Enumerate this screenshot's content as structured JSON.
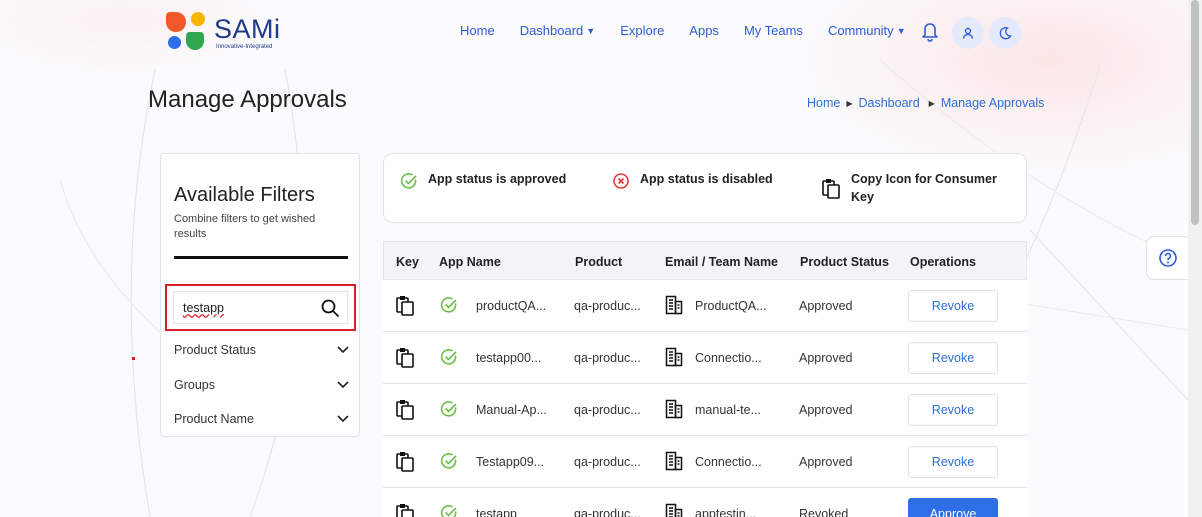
{
  "brand": {
    "name": "SAMi",
    "tagline": "Innovative-Integrated"
  },
  "nav": {
    "items": [
      {
        "label": "Home",
        "dropdown": false
      },
      {
        "label": "Dashboard",
        "dropdown": true
      },
      {
        "label": "Explore",
        "dropdown": false
      },
      {
        "label": "Apps",
        "dropdown": false
      },
      {
        "label": "My Teams",
        "dropdown": false
      },
      {
        "label": "Community",
        "dropdown": true
      }
    ],
    "icons": [
      "bell-icon",
      "user-icon",
      "moon-icon"
    ]
  },
  "page": {
    "title": "Manage Approvals"
  },
  "breadcrumb": [
    "Home",
    "Dashboard",
    "Manage Approvals"
  ],
  "filters": {
    "title": "Available Filters",
    "subtitle": "Combine filters to get wished results",
    "search_value": "testapp",
    "groups": [
      "Product Status",
      "Groups",
      "Product Name"
    ]
  },
  "legend": {
    "approved": "App status is approved",
    "disabled": "App status is disabled",
    "copy": "Copy Icon for Consumer Key"
  },
  "table": {
    "columns": [
      "Key",
      "App Name",
      "Product",
      "Email / Team Name",
      "Product Status",
      "Operations"
    ],
    "rows": [
      {
        "app": "productQA...",
        "product": "qa-produc...",
        "team": "ProductQA...",
        "status": "Approved",
        "action": "Revoke"
      },
      {
        "app": "testapp00...",
        "product": "qa-produc...",
        "team": "Connectio...",
        "status": "Approved",
        "action": "Revoke"
      },
      {
        "app": "Manual-Ap...",
        "product": "qa-produc...",
        "team": "manual-te...",
        "status": "Approved",
        "action": "Revoke"
      },
      {
        "app": "Testapp09...",
        "product": "qa-produc...",
        "team": "Connectio...",
        "status": "Approved",
        "action": "Revoke"
      },
      {
        "app": "testapp",
        "product": "qa-produc...",
        "team": "apptestin...",
        "status": "Revoked",
        "action": "Approve"
      }
    ]
  },
  "colors": {
    "accent": "#2e6ee6",
    "link": "#2d6fd6",
    "approved": "#6cc04a",
    "disabled": "#e5383b",
    "highlight": "#d6202a"
  }
}
